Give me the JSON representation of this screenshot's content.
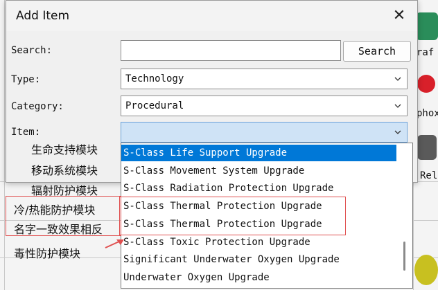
{
  "dialog": {
    "title": "Add Item",
    "close_glyph": "✕",
    "search_label": "Search:",
    "search_value": "",
    "search_button": "Search",
    "type_label": "Type:",
    "type_value": "Technology",
    "category_label": "Category:",
    "category_value": "Procedural",
    "item_label": "Item:",
    "item_value": ""
  },
  "dropdown": {
    "options": [
      "S-Class Life Support Upgrade",
      "S-Class Movement System Upgrade",
      "S-Class Radiation Protection Upgrade",
      "S-Class Thermal Protection Upgrade",
      "S-Class Thermal Protection Upgrade",
      "S-Class Toxic Protection Upgrade",
      "Significant Underwater Oxygen Upgrade",
      "Underwater Oxygen Upgrade"
    ]
  },
  "annotations": {
    "line1": "生命支持模块",
    "line2": "移动系统模块",
    "line3": "辐射防护模块",
    "line4": "冷/热能防护模块",
    "line5": "名字一致效果相反",
    "line6": "毒性防护模块",
    "accent_color": "#e05050"
  },
  "background": {
    "peek_1": "raf",
    "peek_2": "phox",
    "peek_3": "Rel"
  },
  "colors": {
    "selected_bg": "#0078d7",
    "selected_fg": "#ffffff",
    "active_field_bg": "#cfe3f6"
  }
}
